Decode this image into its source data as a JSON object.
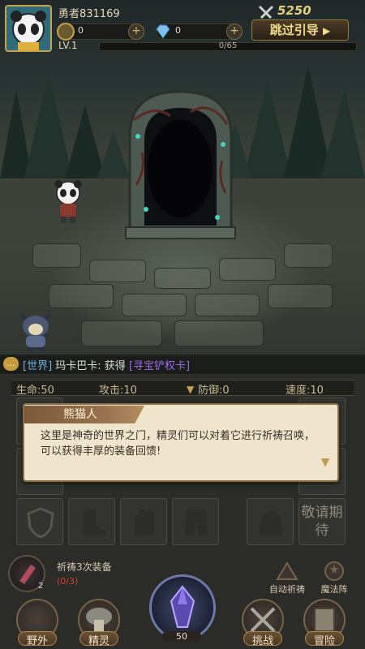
{
  "hud": {
    "player_name": "勇者831169",
    "level": "LV.1",
    "exp": "0/65",
    "coupon_value": "0",
    "gem_value": "0",
    "money": "5250",
    "skip_label": "跳过引导"
  },
  "chat": {
    "channel": "[世界]",
    "message": "玛卡巴卡: 获得",
    "item": "[寻宝铲权卡]"
  },
  "stats": {
    "hp": "生命:50",
    "atk": "攻击:10",
    "def": "防御:0",
    "spd": "速度:10"
  },
  "dialog": {
    "speaker": "熊猫人",
    "text": "这里是神奇的世界之门，精灵们可以对着它进行祈祷召唤，可以获得丰厚的装备回馈!"
  },
  "slot_wait": "敬请期待",
  "task": {
    "count": "2",
    "title": "祈祷3次装备",
    "progress": "(0/3)"
  },
  "side_buttons": {
    "auto_pray": "自动祈祷",
    "magic_array": "魔法阵"
  },
  "center": {
    "count": "50"
  },
  "nav": {
    "field": "野外",
    "spirit": "精灵",
    "challenge": "挑战",
    "adventure": "冒险"
  },
  "colors": {
    "accent_gold": "#c8a54e",
    "chat_channel": "#6fb0e8",
    "chat_item": "#9c6ae8",
    "task_progress": "#d23c3c"
  }
}
